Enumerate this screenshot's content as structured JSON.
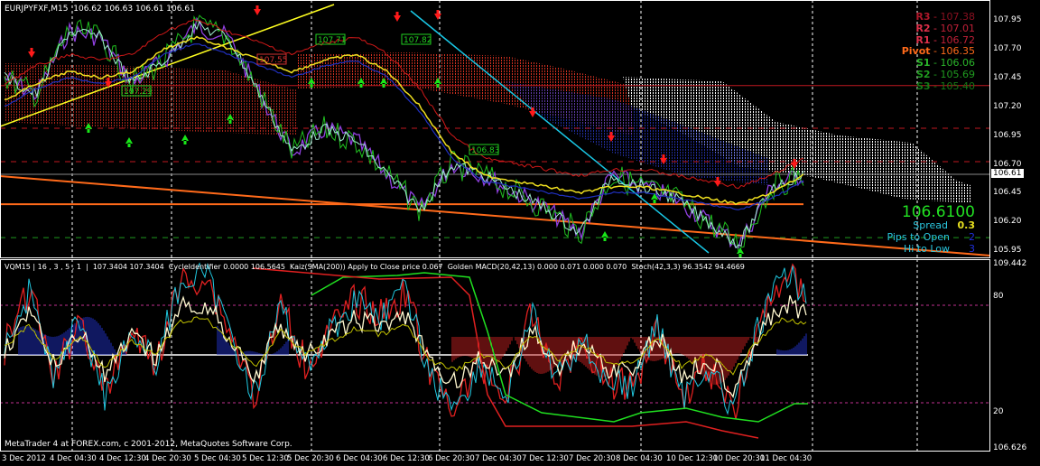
{
  "window": {
    "title": "EURJPYFXF,M15",
    "ohlc": "106.62 106.63 106.61 106.61"
  },
  "price_axis": [
    "107.95",
    "107.70",
    "107.45",
    "107.20",
    "106.95",
    "106.70",
    "106.45",
    "106.20",
    "105.95"
  ],
  "current_price_tag": "106.61",
  "pivots": [
    {
      "label": "R3",
      "value": "107.38",
      "label_color": "#b0182a",
      "value_color": "#8a1020"
    },
    {
      "label": "R2",
      "value": "107.01",
      "label_color": "#e0304a",
      "value_color": "#c02038"
    },
    {
      "label": "R1",
      "value": "106.72",
      "label_color": "#e0304a",
      "value_color": "#c02038"
    },
    {
      "label": "Pivot",
      "value": "106.35",
      "label_color": "#ff6a1a",
      "value_color": "#ff6a1a"
    },
    {
      "label": "S1",
      "value": "106.06",
      "label_color": "#2ab52a",
      "value_color": "#2ab52a"
    },
    {
      "label": "S2",
      "value": "105.69",
      "label_color": "#1f9a1f",
      "value_color": "#1f9a1f"
    },
    {
      "label": "S3",
      "value": "105.40",
      "label_color": "#157a15",
      "value_color": "#157a15"
    }
  ],
  "info": {
    "big_price": "106.6100",
    "spread_label": "Spread",
    "spread_value": "0.3",
    "pips_label": "Pips to Open",
    "pips_value": "2",
    "hilo_label": "Hi to Low",
    "hilo_value": "3"
  },
  "indicator_header": "VQM15 | 16 , 3 , 5 , 1  |  107.3404 107.3404  CycleIdentifier 0.0000 106.5645  Kaiz(SMA(200)) Apply to Close price 0.067  Golden MACD(20,42,13) 0.000 0.071 0.000 0.070  Stoch(42,3,3) 96.3542 94.4669",
  "sub_axis": [
    "109.442",
    "80",
    "20",
    "106.626"
  ],
  "copyright": "MetaTrader 4 at FOREX.com, c 2001-2012, MetaQuotes Software Corp.",
  "time_axis": [
    "3 Dec 2012",
    "4 Dec 04:30",
    "4 Dec 12:30",
    "4 Dec 20:30",
    "5 Dec 04:30",
    "5 Dec 12:30",
    "5 Dec 20:30",
    "6 Dec 04:30",
    "6 Dec 12:30",
    "6 Dec 20:30",
    "7 Dec 04:30",
    "7 Dec 12:30",
    "7 Dec 20:30",
    "8 Dec 04:30",
    "10 Dec 12:30",
    "10 Dec 20:30",
    "11 Dec 04:30"
  ],
  "box_labels": [
    "107.29",
    "107.55",
    "107.71",
    "107.82",
    "106.83"
  ],
  "colors": {
    "up_arrow": "#19e619",
    "down_arrow": "#ff1a1a",
    "bg": "#000000",
    "grid": "#ffffff"
  },
  "chart_data": {
    "type": "line",
    "title": "EURJPYFXF,M15",
    "ylim": [
      105.9,
      108.1
    ],
    "series": [
      {
        "name": "close",
        "values": [
          107.45,
          107.3,
          107.85,
          107.8,
          107.4,
          107.6,
          107.9,
          107.8,
          107.3,
          106.8,
          107.0,
          106.9,
          106.6,
          106.3,
          106.7,
          106.6,
          106.45,
          106.3,
          106.1,
          106.6,
          106.5,
          106.4,
          106.2,
          106.0,
          106.5,
          106.61
        ]
      },
      {
        "name": "ma_yellow",
        "values": [
          107.25,
          107.4,
          107.5,
          107.45,
          107.5,
          107.7,
          107.8,
          107.7,
          107.6,
          107.5,
          107.6,
          107.65,
          107.5,
          107.2,
          106.8,
          106.6,
          106.55,
          106.5,
          106.45,
          106.5,
          106.5,
          106.45,
          106.4,
          106.35,
          106.45,
          106.6
        ]
      }
    ]
  }
}
